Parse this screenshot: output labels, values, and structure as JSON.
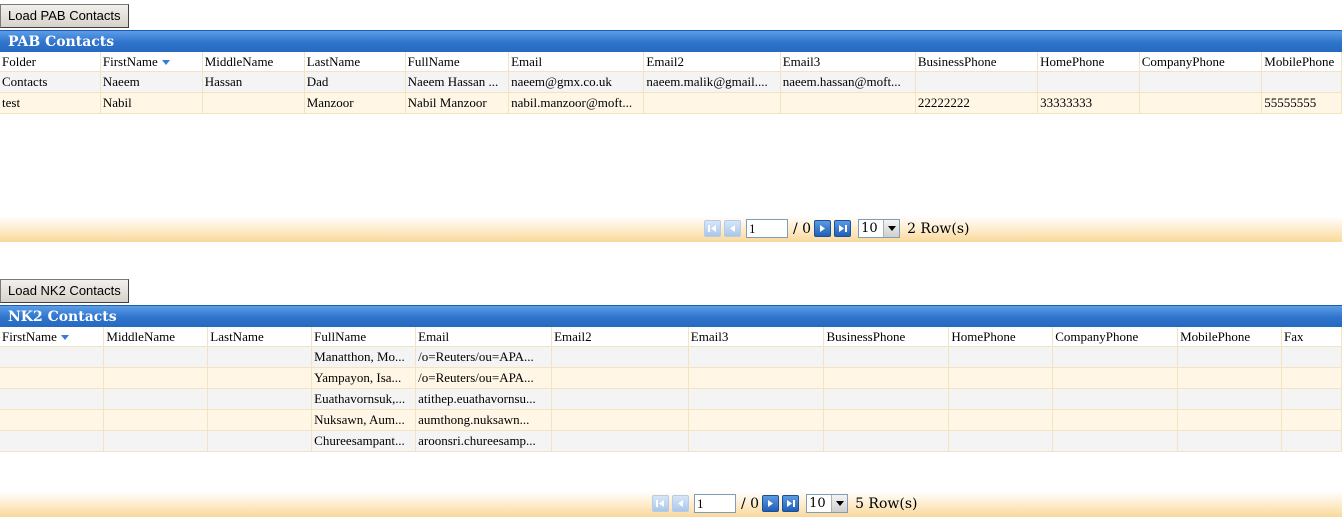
{
  "pab": {
    "load_button": "Load PAB Contacts",
    "title": "PAB Contacts",
    "columns": [
      "Folder",
      "FirstName",
      "MiddleName",
      "LastName",
      "FullName",
      "Email",
      "Email2",
      "Email3",
      "BusinessPhone",
      "HomePhone",
      "CompanyPhone",
      "MobilePhone"
    ],
    "sorted_column": "FirstName",
    "rows": [
      [
        "Contacts",
        "Naeem",
        "Hassan",
        "Dad",
        "Naeem Hassan ...",
        "naeem@gmx.co.uk",
        "naeem.malik@gmail....",
        "naeem.hassan@moft...",
        "",
        "",
        "",
        ""
      ],
      [
        "test",
        "Nabil",
        "",
        "Manzoor",
        "Nabil Manzoor",
        "nabil.manzoor@moft...",
        "",
        "",
        "22222222",
        "33333333",
        "",
        "55555555"
      ]
    ],
    "pager": {
      "page": "1",
      "total": "/ 0",
      "page_size": "10",
      "row_count": "2 Row(s)"
    }
  },
  "nk2": {
    "load_button": "Load NK2 Contacts",
    "title": "NK2 Contacts",
    "columns": [
      "FirstName",
      "MiddleName",
      "LastName",
      "FullName",
      "Email",
      "Email2",
      "Email3",
      "BusinessPhone",
      "HomePhone",
      "CompanyPhone",
      "MobilePhone",
      "Fax"
    ],
    "sorted_column": "FirstName",
    "rows": [
      [
        "",
        "",
        "",
        "Manatthon, Mo...",
        "/o=Reuters/ou=APA...",
        "",
        "",
        "",
        "",
        "",
        "",
        ""
      ],
      [
        "",
        "",
        "",
        "Yampayon, Isa...",
        "/o=Reuters/ou=APA...",
        "",
        "",
        "",
        "",
        "",
        "",
        ""
      ],
      [
        "",
        "",
        "",
        "Euathavornsuk,...",
        "atithep.euathavornsu...",
        "",
        "",
        "",
        "",
        "",
        "",
        ""
      ],
      [
        "",
        "",
        "",
        "Nuksawn, Aum...",
        "aumthong.nuksawn...",
        "",
        "",
        "",
        "",
        "",
        "",
        ""
      ],
      [
        "",
        "",
        "",
        "Chureesampant...",
        "aroonsri.chureesamp...",
        "",
        "",
        "",
        "",
        "",
        "",
        ""
      ]
    ],
    "pager": {
      "page": "1",
      "total": "/ 0",
      "page_size": "10",
      "row_count": "5 Row(s)"
    }
  }
}
